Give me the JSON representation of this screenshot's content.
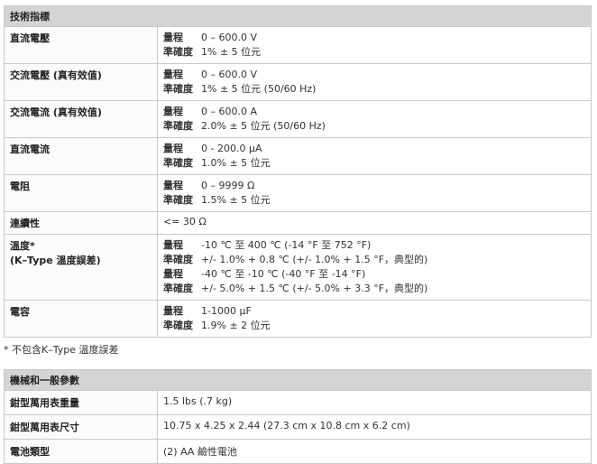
{
  "spec_table": {
    "header": "技術指標",
    "rows": [
      {
        "label": "直流電壓",
        "lines": [
          {
            "key": "量程",
            "value": "0 – 600.0 V"
          },
          {
            "key": "準確度",
            "value": "1% ± 5 位元"
          }
        ]
      },
      {
        "label": "交流電壓 (真有效值)",
        "lines": [
          {
            "key": "量程",
            "value": "0 – 600.0 V"
          },
          {
            "key": "準確度",
            "value": "1% ± 5 位元 (50/60 Hz)"
          }
        ]
      },
      {
        "label": "交流電流 (真有效值)",
        "lines": [
          {
            "key": "量程",
            "value": "0 – 600.0 A"
          },
          {
            "key": "準確度",
            "value": "2.0% ± 5 位元 (50/60 Hz)"
          }
        ]
      },
      {
        "label": "直流電流",
        "lines": [
          {
            "key": "量程",
            "value": "0 - 200.0 µA"
          },
          {
            "key": "準確度",
            "value": "1.0% ± 5 位元"
          }
        ]
      },
      {
        "label": "電阻",
        "lines": [
          {
            "key": "量程",
            "value": "0 – 9999 Ω"
          },
          {
            "key": "準確度",
            "value": "1.5% ± 5 位元"
          }
        ]
      },
      {
        "label": "連續性",
        "plain": "<= 30 Ω"
      },
      {
        "label": "溫度*",
        "label2": "(K–Type 溫度誤差)",
        "lines": [
          {
            "key": "量程",
            "value": "-10 ℃ 至 400 ℃ (-14 °F 至 752 °F)"
          },
          {
            "key": "準確度",
            "value": "+/- 1.0% + 0.8 ℃ (+/- 1.0% + 1.5 °F，典型的)"
          },
          {
            "key": "量程",
            "value": "-40 ℃ 至 -10 ℃ (-40  °F 至 -14 °F)"
          },
          {
            "key": "準確度",
            "value": "+/- 5.0% + 1.5 ℃ (+/- 5.0% + 3.3 °F，典型的)"
          }
        ]
      },
      {
        "label": "電容",
        "lines": [
          {
            "key": "量程",
            "value": "1-1000 µF"
          },
          {
            "key": "準確度",
            "value": "1.9% ± 2 位元"
          }
        ]
      }
    ]
  },
  "footnote": "* 不包含K–Type 溫度誤差",
  "mech_table": {
    "header": "機械和一般參數",
    "rows": [
      {
        "label": "鉗型萬用表重量",
        "value": "1.5 lbs (.7 kg)"
      },
      {
        "label": "鉗型萬用表尺寸",
        "value": "10.75 x 4.25 x 2.44 (27.3 cm x 10.8 cm x 6.2 cm)"
      },
      {
        "label": "電池類型",
        "value": "(2) AA 鹼性電池"
      }
    ]
  }
}
